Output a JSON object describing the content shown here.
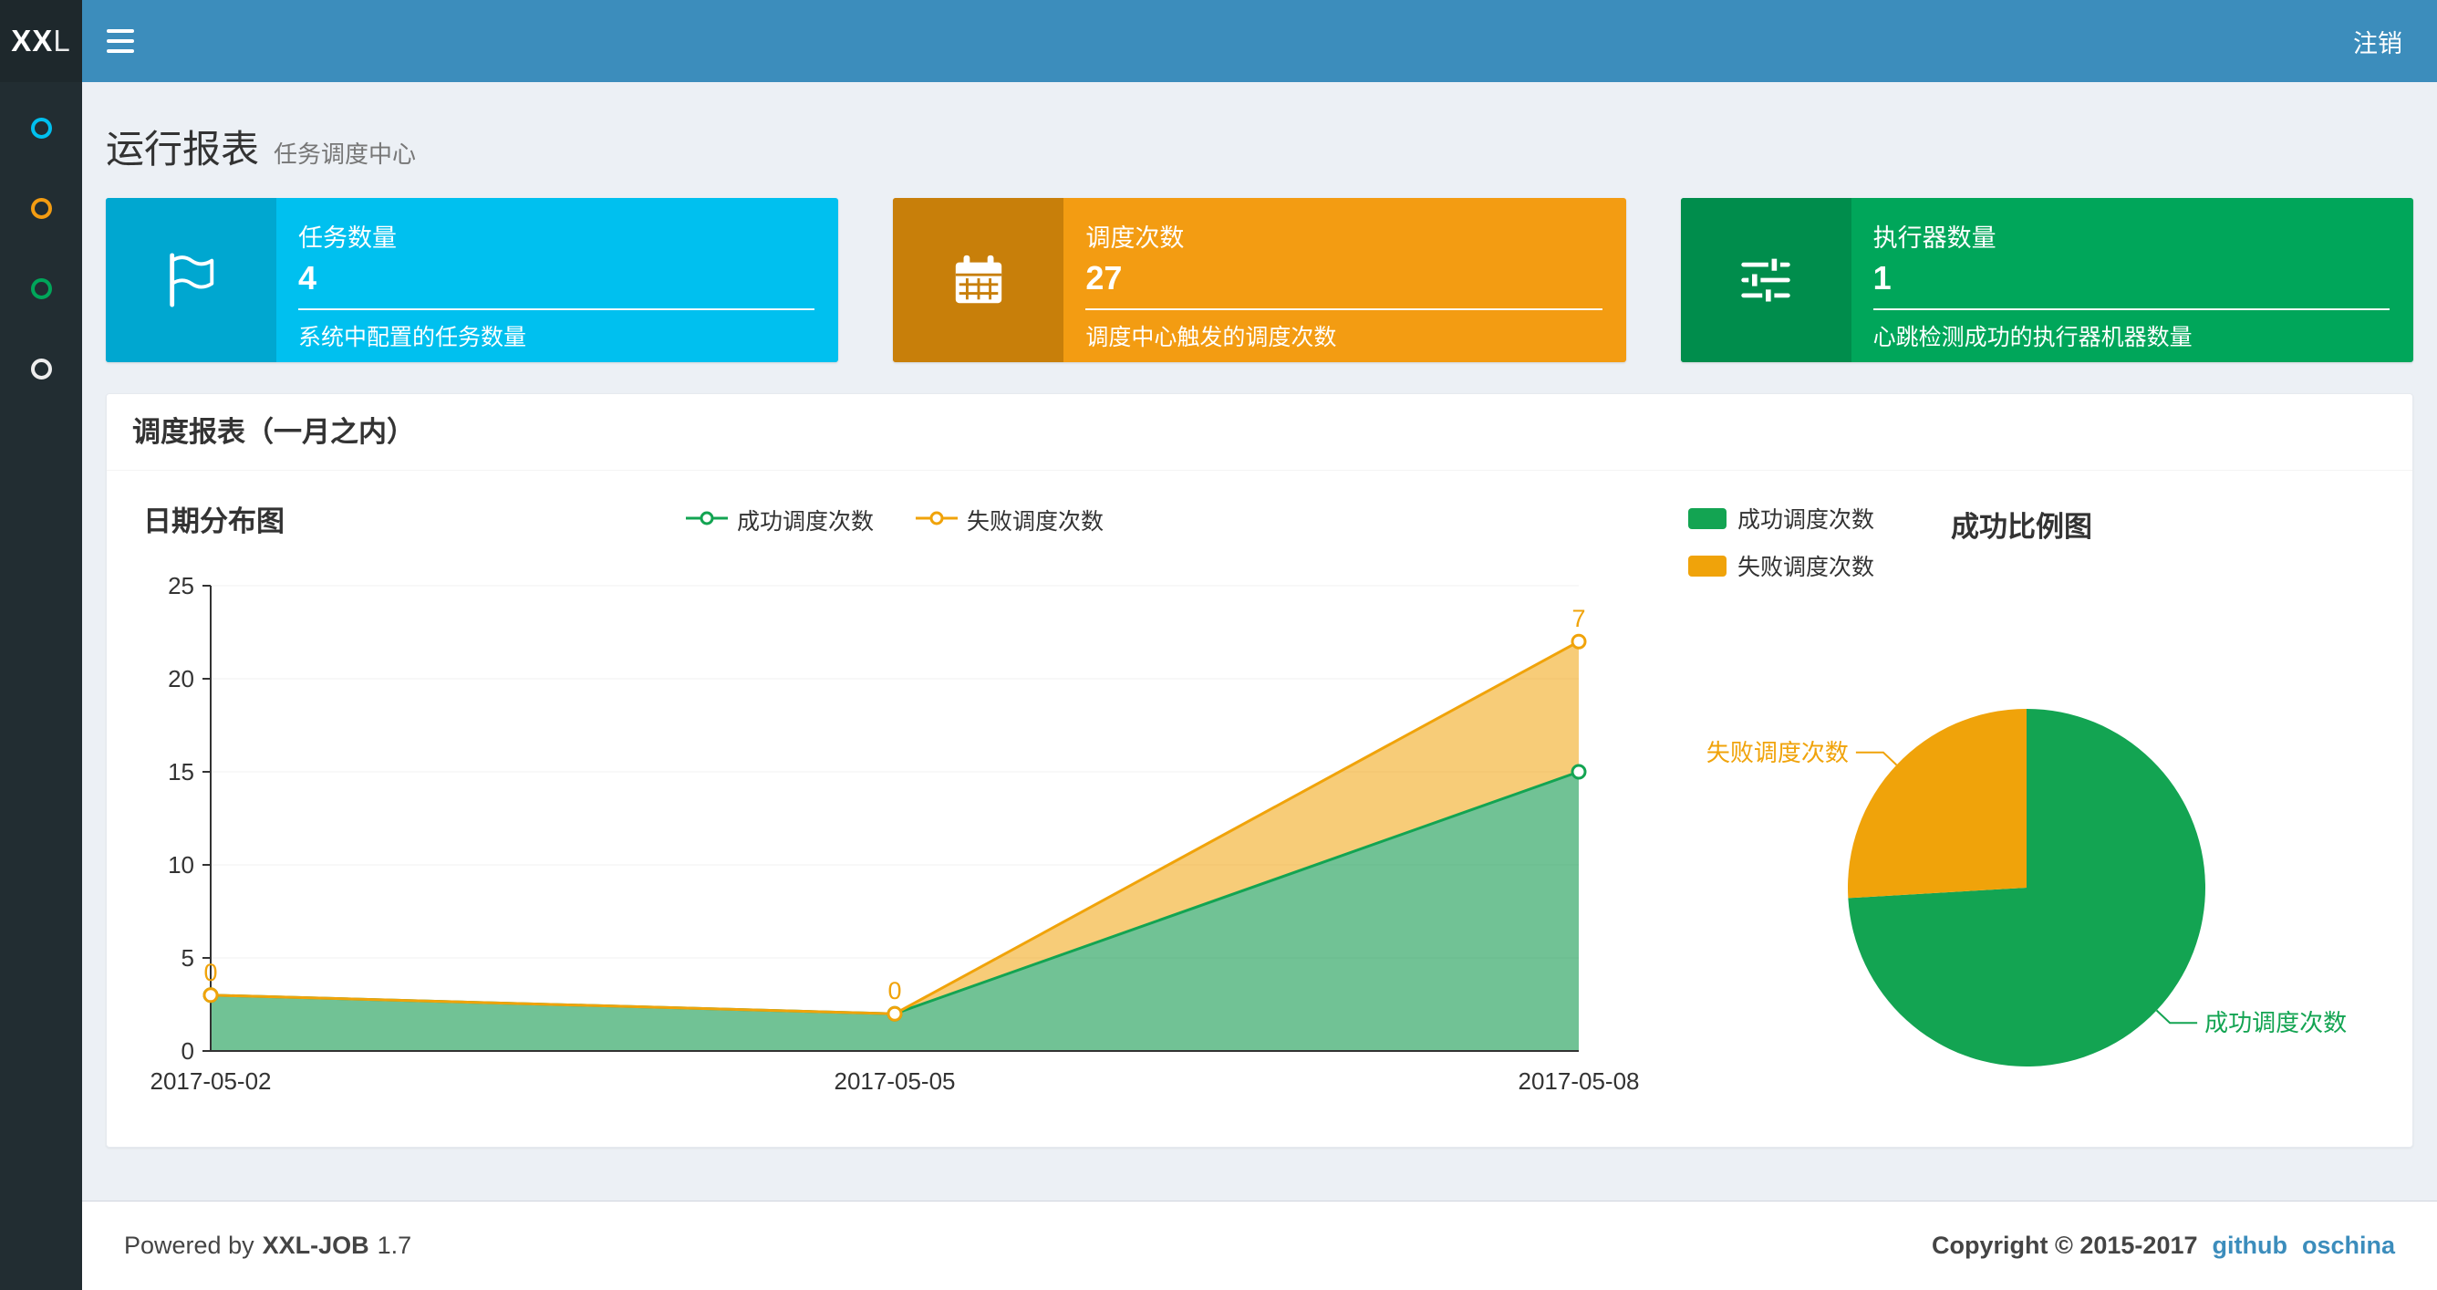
{
  "navbar": {
    "logo_bold": "XX",
    "logo_rest": "L",
    "logout": "注销"
  },
  "sidebar": {
    "items": [
      {
        "color": "#00c0ef"
      },
      {
        "color": "#f39c12"
      },
      {
        "color": "#00a65a"
      },
      {
        "color": "#eeeeee"
      }
    ]
  },
  "header": {
    "title": "运行报表",
    "subtitle": "任务调度中心"
  },
  "info_boxes": [
    {
      "title": "任务数量",
      "value": "4",
      "desc": "系统中配置的任务数量",
      "color": "#00c0ef",
      "icon_bg": "#00a7d0",
      "icon": "flag"
    },
    {
      "title": "调度次数",
      "value": "27",
      "desc": "调度中心触发的调度次数",
      "color": "#f39c12",
      "icon_bg": "#c87f0a",
      "icon": "calendar"
    },
    {
      "title": "执行器数量",
      "value": "1",
      "desc": "心跳检测成功的执行器机器数量",
      "color": "#00a65a",
      "icon_bg": "#008d4c",
      "icon": "sliders"
    }
  ],
  "panel": {
    "title": "调度报表（一月之内）"
  },
  "chart_data": [
    {
      "type": "area",
      "title": "日期分布图",
      "stacked": true,
      "x": [
        "2017-05-02",
        "2017-05-05",
        "2017-05-08"
      ],
      "ylim": [
        0,
        25
      ],
      "yticks": [
        0,
        5,
        10,
        15,
        20,
        25
      ],
      "grid": true,
      "legend_position": "top",
      "series": [
        {
          "name": "成功调度次数",
          "values": [
            3,
            2,
            15
          ],
          "color": "#13a452",
          "fill": "rgba(26,156,84,0.62)"
        },
        {
          "name": "失败调度次数",
          "values": [
            0,
            0,
            7
          ],
          "color": "#f0a30a",
          "fill": "rgba(240,163,10,0.55)",
          "point_labels": [
            "0",
            "0",
            "7"
          ]
        }
      ]
    },
    {
      "type": "pie",
      "title": "成功比例图",
      "legend_position": "top-left",
      "slices": [
        {
          "label": "成功调度次数",
          "value": 20,
          "color": "#13a452"
        },
        {
          "label": "失败调度次数",
          "value": 7,
          "color": "#f0a30a"
        }
      ]
    }
  ],
  "footer": {
    "powered_prefix": "Powered by",
    "product": "XXL-JOB",
    "version": "1.7",
    "copyright": "Copyright © 2015-2017",
    "links": [
      {
        "label": "github"
      },
      {
        "label": "oschina"
      }
    ]
  }
}
